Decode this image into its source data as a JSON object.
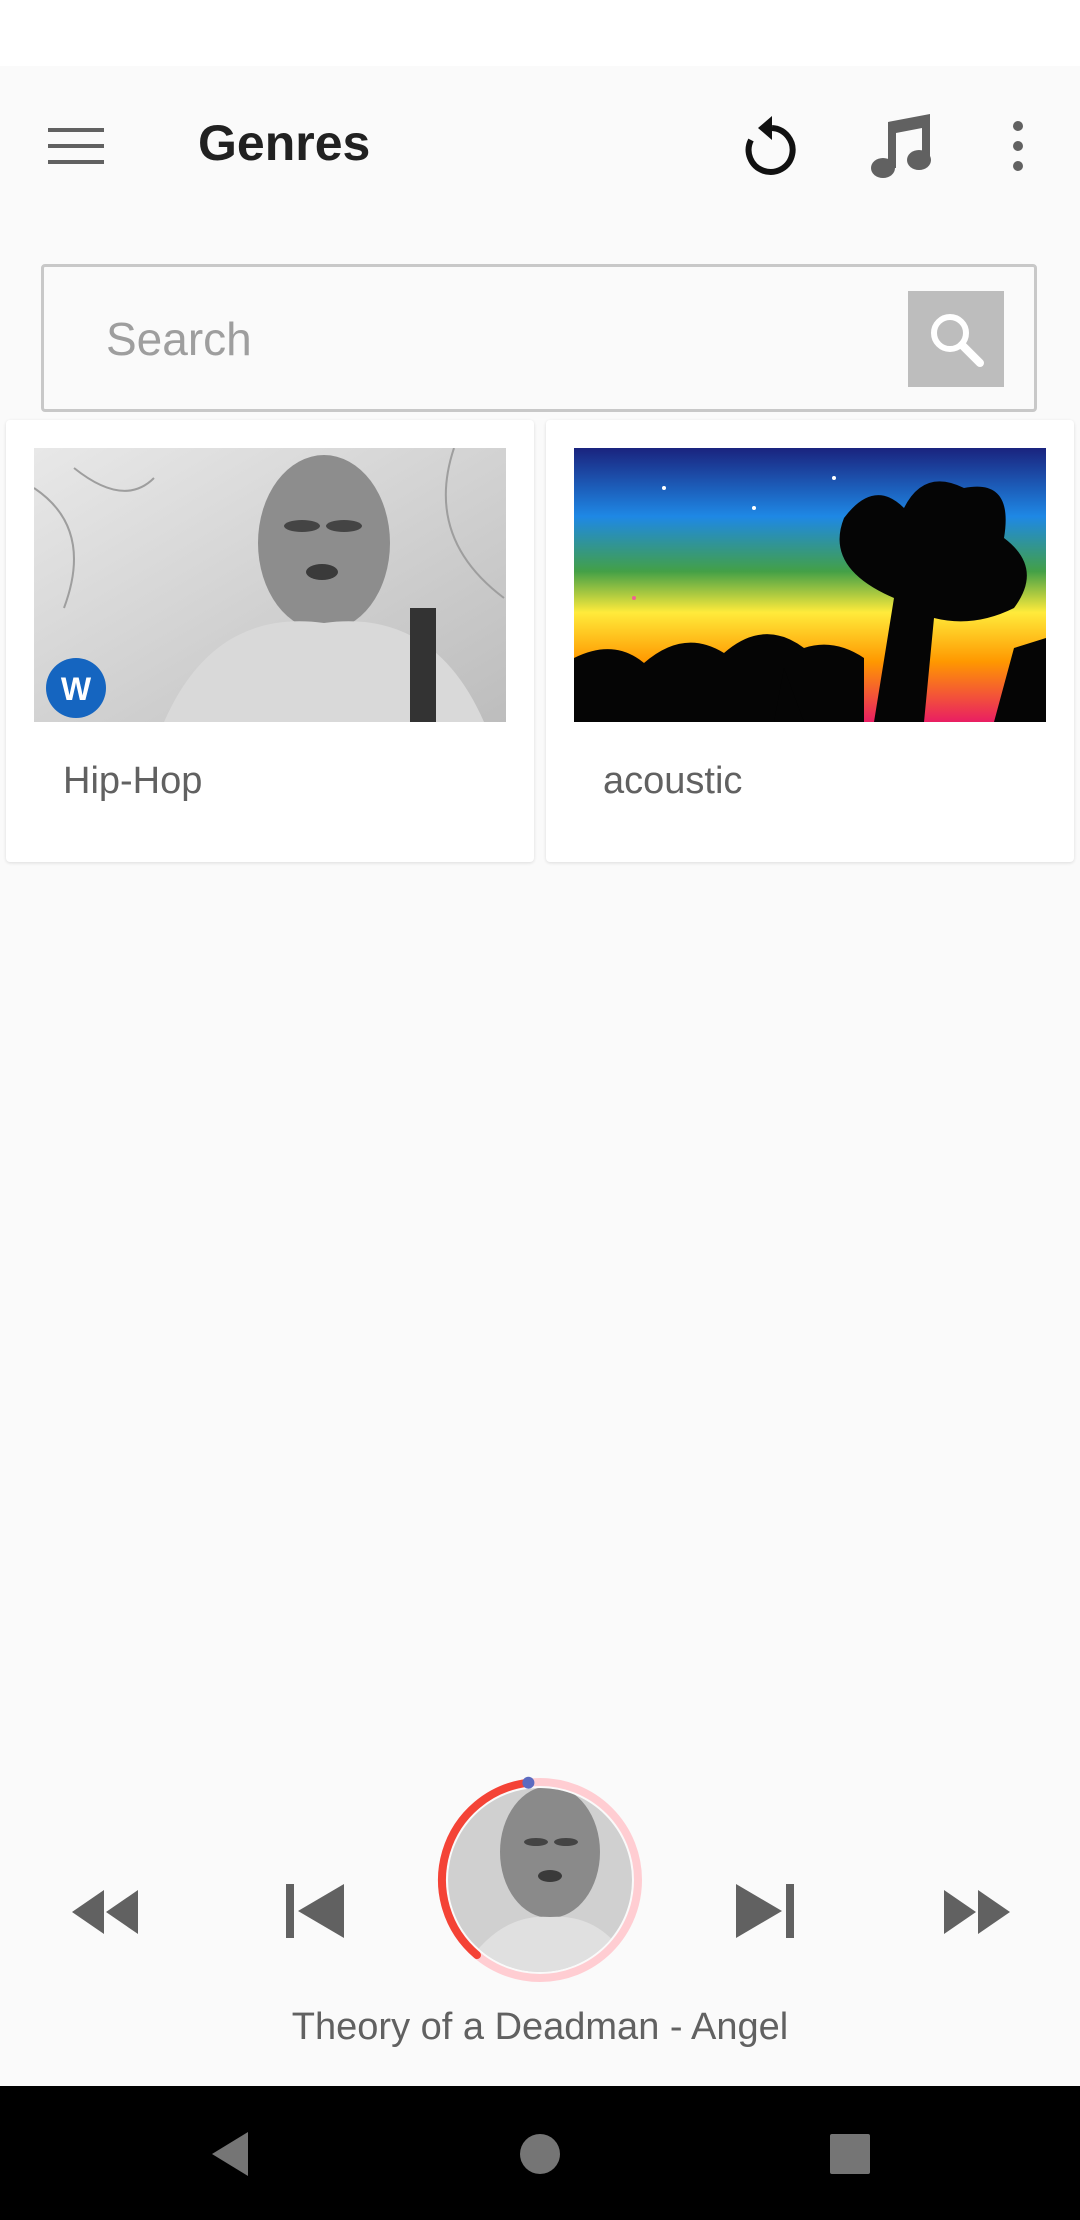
{
  "app_bar": {
    "title": "Genres",
    "icons": [
      "menu-icon",
      "replay-icon",
      "music-note-icon",
      "more-vert-icon"
    ]
  },
  "search": {
    "placeholder": "Search",
    "value": "",
    "button_icon": "search-icon"
  },
  "genres": [
    {
      "label": "Hip-Hop"
    },
    {
      "label": "acoustic"
    }
  ],
  "player": {
    "track": "Theory of a Deadman - Angel",
    "progress_fraction": 0.37,
    "icons": [
      "fast-rewind-icon",
      "skip-previous-icon",
      "skip-next-icon",
      "fast-forward-icon"
    ]
  },
  "system_nav": {
    "icons": [
      "nav-back-icon",
      "nav-home-icon",
      "nav-recents-icon"
    ]
  },
  "colors": {
    "progress": "#f44336",
    "progress_track": "#ffcdd2",
    "progress_knob": "#5c6bc0",
    "search_button": "#bdbdbd"
  }
}
